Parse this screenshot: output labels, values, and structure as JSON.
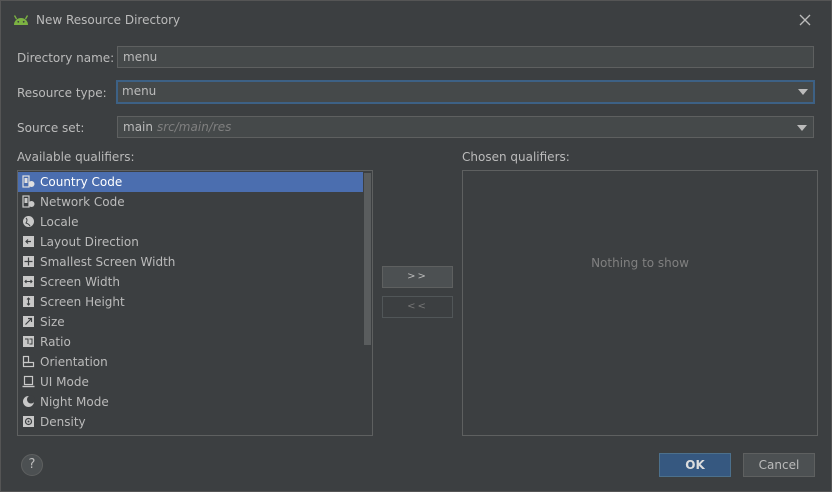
{
  "window": {
    "title": "New Resource Directory"
  },
  "form": {
    "directory_name": {
      "label": "Directory name:",
      "value": "menu"
    },
    "resource_type": {
      "label": "Resource type:",
      "value": "menu"
    },
    "source_set": {
      "label": "Source set:",
      "value": "main",
      "hint": "src/main/res"
    }
  },
  "qualifiers": {
    "available_label": "Available qualifiers:",
    "chosen_label": "Chosen qualifiers:",
    "items": [
      {
        "label": "Country Code",
        "icon": "country-code-icon",
        "selected": true
      },
      {
        "label": "Network Code",
        "icon": "network-code-icon"
      },
      {
        "label": "Locale",
        "icon": "globe-icon"
      },
      {
        "label": "Layout Direction",
        "icon": "layout-direction-icon"
      },
      {
        "label": "Smallest Screen Width",
        "icon": "smallest-width-icon"
      },
      {
        "label": "Screen Width",
        "icon": "screen-width-icon"
      },
      {
        "label": "Screen Height",
        "icon": "screen-height-icon"
      },
      {
        "label": "Size",
        "icon": "size-icon"
      },
      {
        "label": "Ratio",
        "icon": "ratio-icon"
      },
      {
        "label": "Orientation",
        "icon": "orientation-icon"
      },
      {
        "label": "UI Mode",
        "icon": "ui-mode-icon"
      },
      {
        "label": "Night Mode",
        "icon": "night-mode-icon"
      },
      {
        "label": "Density",
        "icon": "density-icon"
      }
    ],
    "add_button": ">>",
    "remove_button": "<<",
    "empty_text": "Nothing to show"
  },
  "buttons": {
    "help": "?",
    "ok": "OK",
    "cancel": "Cancel"
  },
  "colors": {
    "selection": "#4b6eaf",
    "ok_button": "#365880",
    "focus_border": "#3d6185",
    "android_green": "#7cb342"
  }
}
